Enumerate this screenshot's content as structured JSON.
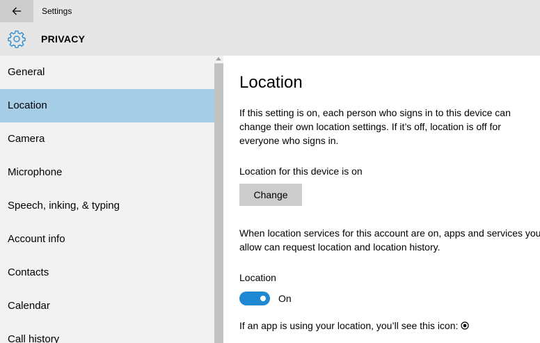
{
  "window": {
    "title": "Settings",
    "back_icon": "arrow-left-icon"
  },
  "header": {
    "icon": "gear-icon",
    "title": "PRIVACY",
    "accent": "#1f88d2"
  },
  "sidebar": {
    "selected_color": "#a6cde6",
    "items": [
      {
        "label": "General"
      },
      {
        "label": "Location",
        "selected": true
      },
      {
        "label": "Camera"
      },
      {
        "label": "Microphone"
      },
      {
        "label": "Speech, inking, & typing"
      },
      {
        "label": "Account info"
      },
      {
        "label": "Contacts"
      },
      {
        "label": "Calendar"
      },
      {
        "label": "Call history"
      }
    ]
  },
  "main": {
    "title": "Location",
    "description": "If this setting is on, each person who signs in to this device can change their own location settings. If it’s off, location is off for everyone who signs in.",
    "device_status": "Location for this device is on",
    "change_label": "Change",
    "account_description": "When location services for this account are on, apps and services you allow can request location and location history.",
    "toggle_label": "Location",
    "toggle_state": "On",
    "toggle_on": true,
    "icon_note": "If an app is using your location, you’ll see this icon:",
    "location_icon": "location-dot-icon"
  }
}
